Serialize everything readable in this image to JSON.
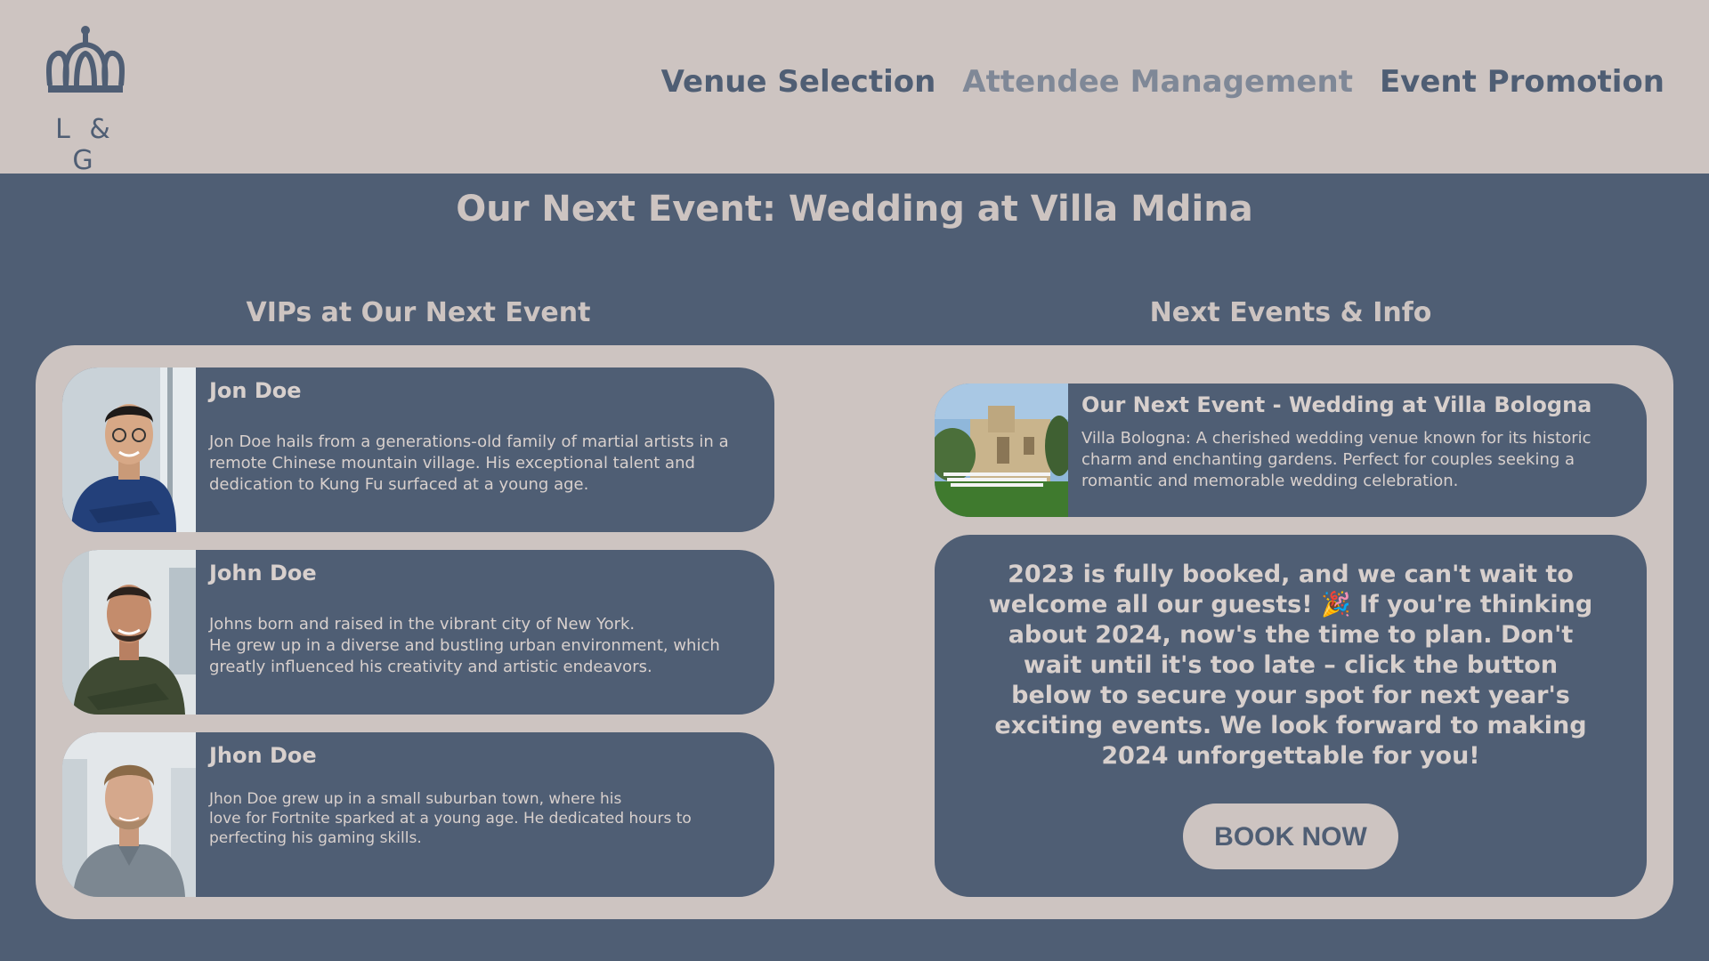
{
  "header": {
    "logo_text": "L & G",
    "nav": [
      {
        "label": "Venue Selection"
      },
      {
        "label": "Attendee Management"
      },
      {
        "label": "Event Promotion"
      }
    ]
  },
  "main": {
    "title": "Our Next Event: Wedding at Villa Mdina"
  },
  "vips": {
    "heading": "VIPs at Our Next Event",
    "items": [
      {
        "name": "Jon Doe",
        "bio": "Jon Doe hails from a generations-old family of martial artists in a remote Chinese mountain village. His exceptional talent and dedication to Kung Fu surfaced at a young age."
      },
      {
        "name": "John Doe",
        "bio": "Johns born and raised in the vibrant city of New York.\nHe grew up in a diverse and bustling urban environment, which greatly influenced his creativity and artistic endeavors."
      },
      {
        "name": "Jhon Doe",
        "bio": "Jhon Doe grew up in a small suburban town, where his\nlove for Fortnite sparked at a young age. He dedicated hours to perfecting his gaming skills."
      }
    ]
  },
  "events": {
    "heading": "Next Events & Info",
    "next_event": {
      "title": "Our Next Event - Wedding at Villa Bologna",
      "description": "Villa Bologna: A cherished wedding venue known for its historic charm and enchanting gardens. Perfect for couples seeking a romantic and memorable wedding celebration."
    },
    "promo": {
      "text": "2023 is fully booked, and we can't wait to welcome all our guests! 🎉 If you're thinking about 2024, now's the time to plan. Don't wait until it's too late – click the button below to secure your spot for next year's exciting events. We look forward to making 2024 unforgettable for you!",
      "button_label": "BOOK NOW"
    }
  },
  "colors": {
    "primary": "#4f5e74",
    "background_light": "#cdc4c1",
    "nav_muted": "#7f8897"
  },
  "icons": {
    "logo": "crown-icon"
  }
}
